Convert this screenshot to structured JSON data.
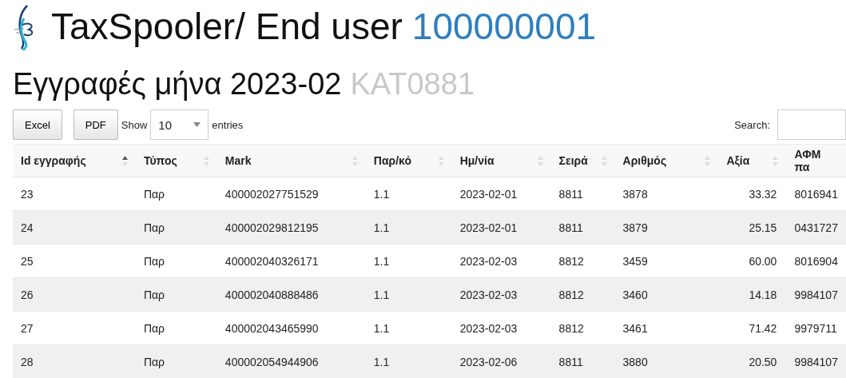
{
  "header": {
    "title": "TaxSpooler/ End user",
    "user_id": "100000001"
  },
  "subheader": {
    "title": "Εγγραφές μήνα 2023-02",
    "code": "KAT0881"
  },
  "toolbar": {
    "buttons": [
      "Excel",
      "PDF"
    ],
    "show_label": "Show",
    "page_size": "10",
    "entries_label": "entries",
    "search_label": "Search:"
  },
  "table": {
    "columns": [
      {
        "label": "Id εγγραφής",
        "sorted": true,
        "kind": "text"
      },
      {
        "label": "Τύπος",
        "sorted": false,
        "kind": "text"
      },
      {
        "label": "Mark",
        "sorted": false,
        "kind": "text"
      },
      {
        "label": "Παρ/κό",
        "sorted": false,
        "kind": "text"
      },
      {
        "label": "Ημ/νία",
        "sorted": false,
        "kind": "text"
      },
      {
        "label": "Σειρά",
        "sorted": false,
        "kind": "text"
      },
      {
        "label": "Αριθμός",
        "sorted": false,
        "kind": "text"
      },
      {
        "label": "Αξία",
        "sorted": false,
        "kind": "amount"
      },
      {
        "label": "ΑΦΜ πα",
        "kind": "text"
      }
    ],
    "rows": [
      [
        "23",
        "Παρ",
        "400002027751529",
        "1.1",
        "2023-02-01",
        "8811",
        "3878",
        "33.32",
        "8016941"
      ],
      [
        "24",
        "Παρ",
        "400002029812195",
        "1.1",
        "2023-02-01",
        "8811",
        "3879",
        "25.15",
        "0431727"
      ],
      [
        "25",
        "Παρ",
        "400002040326171",
        "1.1",
        "2023-02-03",
        "8812",
        "3459",
        "60.00",
        "8016904"
      ],
      [
        "26",
        "Παρ",
        "400002040888486",
        "1.1",
        "2023-02-03",
        "8812",
        "3460",
        "14.18",
        "9984107"
      ],
      [
        "27",
        "Παρ",
        "400002043465990",
        "1.1",
        "2023-02-03",
        "8812",
        "3461",
        "71.42",
        "9979711"
      ],
      [
        "28",
        "Παρ",
        "400002054944906",
        "1.1",
        "2023-02-06",
        "8811",
        "3880",
        "20.50",
        "9984107"
      ]
    ]
  }
}
